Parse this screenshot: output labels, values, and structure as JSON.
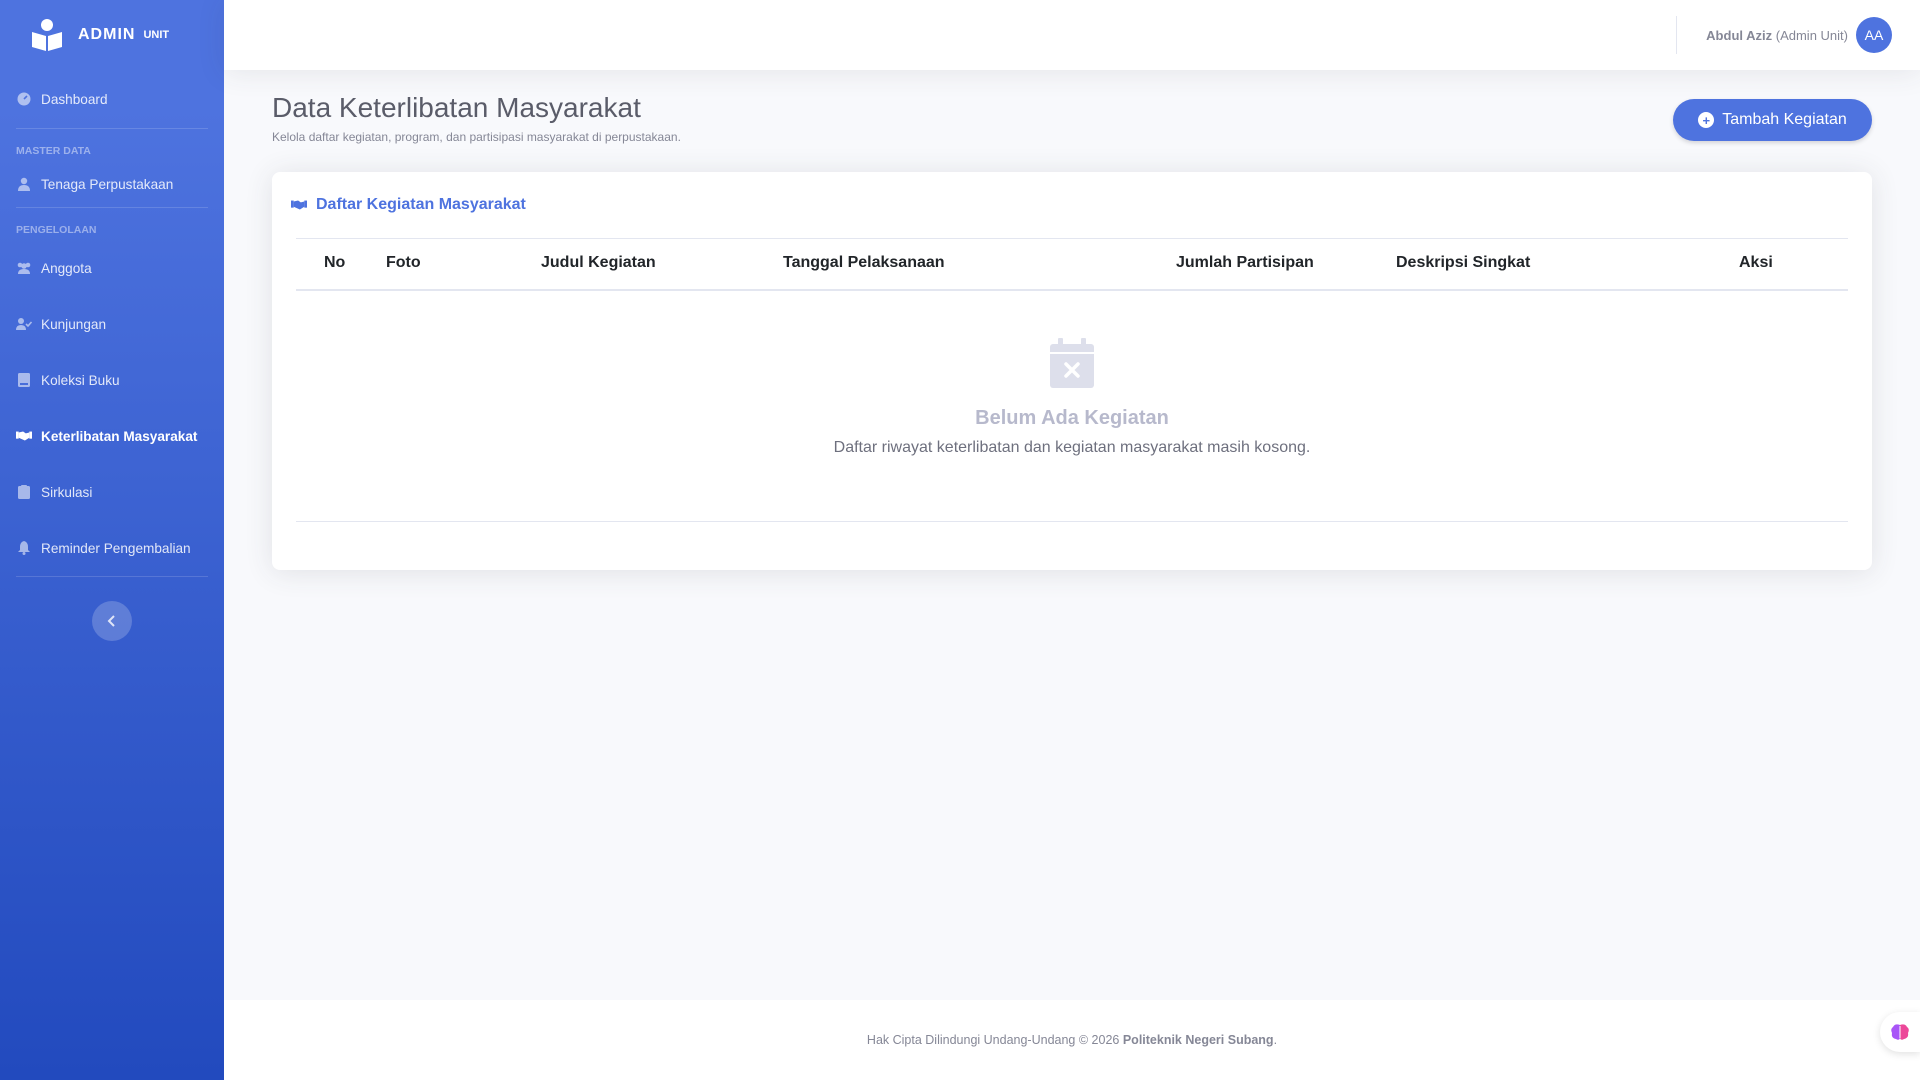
{
  "brand": {
    "title": "ADMIN",
    "sup": "UNIT"
  },
  "sidebar": {
    "dashboard": "Dashboard",
    "heading_master": "MASTER DATA",
    "tenaga": "Tenaga Perpustakaan",
    "heading_pengelolaan": "PENGELOLAAN",
    "items": [
      {
        "label": "Anggota",
        "icon": "users-icon"
      },
      {
        "label": "Kunjungan",
        "icon": "user-check-icon"
      },
      {
        "label": "Koleksi Buku",
        "icon": "book-icon"
      },
      {
        "label": "Keterlibatan Masyarakat",
        "icon": "handshake-icon",
        "active": true
      },
      {
        "label": "Sirkulasi",
        "icon": "clipboard-icon"
      },
      {
        "label": "Reminder Pengembalian",
        "icon": "bell-icon"
      }
    ]
  },
  "topbar": {
    "user_name": "Abdul Aziz",
    "user_role": "(Admin Unit)",
    "avatar_initials": "AA"
  },
  "page": {
    "title": "Data Keterlibatan Masyarakat",
    "subtitle": "Kelola daftar kegiatan, program, dan partisipasi masyarakat di perpustakaan.",
    "add_button": "Tambah Kegiatan"
  },
  "card": {
    "title": "Daftar Kegiatan Masyarakat",
    "columns": [
      "No",
      "Foto",
      "Judul Kegiatan",
      "Tanggal Pelaksanaan",
      "Jumlah Partisipan",
      "Deskripsi Singkat",
      "Aksi"
    ],
    "empty_title": "Belum Ada Kegiatan",
    "empty_desc": "Daftar riwayat keterlibatan dan kegiatan masyarakat masih kosong."
  },
  "footer": {
    "text": "Hak Cipta Dilindungi Undang-Undang © 2026",
    "org": "Politeknik Negeri Subang",
    "end": "."
  },
  "colors": {
    "primary": "#4e73df",
    "primary_dark": "#224abe",
    "background": "#f8f9fc"
  }
}
